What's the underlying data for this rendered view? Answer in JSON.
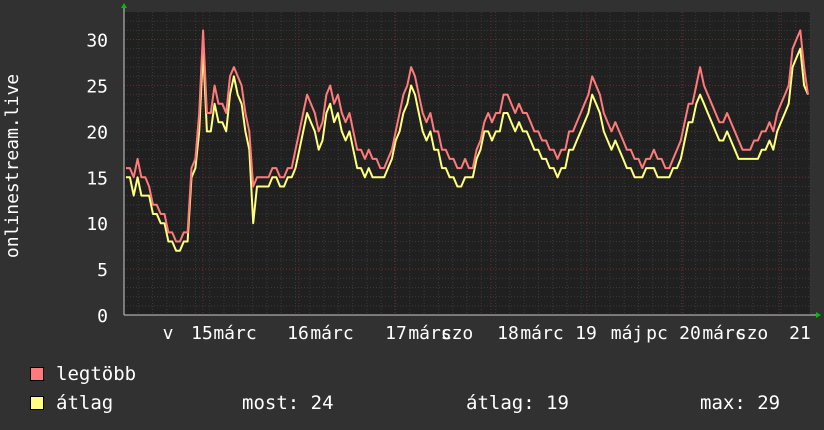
{
  "chart_data": {
    "type": "line",
    "ylabel": "onlinestream.live",
    "ylim": [
      0,
      33
    ],
    "yticks": [
      0,
      5,
      10,
      15,
      20,
      25,
      30
    ],
    "grid": true,
    "x_ticks": [
      "v",
      "15",
      "márc",
      "16",
      "márc",
      "17",
      "márc",
      "szo",
      "18",
      "márc",
      "19",
      "máj",
      "pc",
      "20",
      "márc",
      "szo",
      "21"
    ],
    "x_tick_labels_note_free": true,
    "series": [
      {
        "name": "legtöbb",
        "color": "#ff7b7b",
        "values": [
          16,
          16,
          15,
          17,
          15,
          15,
          14,
          12,
          12,
          11,
          11,
          9,
          9,
          8,
          8,
          9,
          9,
          16,
          17,
          22,
          31,
          22,
          22,
          25,
          23,
          23,
          22,
          26,
          27,
          26,
          25,
          22,
          20,
          14,
          15,
          15,
          15,
          15,
          16,
          16,
          15,
          15,
          16,
          16,
          18,
          20,
          22,
          24,
          23,
          22,
          20,
          21,
          24,
          25,
          23,
          24,
          22,
          21,
          22,
          20,
          18,
          18,
          17,
          18,
          17,
          17,
          16,
          16,
          17,
          18,
          20,
          22,
          24,
          25,
          27,
          26,
          24,
          22,
          21,
          22,
          20,
          20,
          18,
          18,
          17,
          17,
          16,
          16,
          17,
          16,
          16,
          18,
          19,
          21,
          22,
          21,
          22,
          22,
          24,
          24,
          23,
          22,
          23,
          22,
          22,
          21,
          20,
          20,
          19,
          19,
          18,
          18,
          17,
          18,
          18,
          20,
          20,
          21,
          22,
          23,
          24,
          26,
          25,
          24,
          22,
          21,
          20,
          21,
          20,
          19,
          18,
          18,
          17,
          17,
          16,
          17,
          17,
          18,
          17,
          17,
          16,
          16,
          17,
          18,
          19,
          21,
          23,
          23,
          25,
          27,
          25,
          24,
          23,
          22,
          21,
          21,
          22,
          21,
          20,
          19,
          18,
          18,
          18,
          19,
          19,
          20,
          20,
          21,
          20,
          22,
          23,
          24,
          25,
          29,
          30,
          31,
          27,
          24
        ],
        "_note": ""
      },
      {
        "name": "átlag",
        "color": "#ffff80",
        "values": [
          15,
          15,
          13,
          15,
          13,
          13,
          13,
          11,
          11,
          10,
          10,
          8,
          8,
          7,
          7,
          8,
          8,
          15,
          16,
          20,
          29,
          20,
          20,
          23,
          21,
          21,
          20,
          24,
          26,
          24,
          23,
          20,
          18,
          10,
          14,
          14,
          14,
          14,
          15,
          15,
          14,
          14,
          15,
          15,
          16,
          18,
          20,
          22,
          21,
          20,
          18,
          19,
          22,
          23,
          21,
          22,
          20,
          19,
          20,
          18,
          16,
          16,
          15,
          16,
          15,
          15,
          15,
          15,
          16,
          17,
          19,
          20,
          22,
          23,
          25,
          24,
          22,
          20,
          19,
          20,
          18,
          18,
          16,
          16,
          15,
          15,
          14,
          14,
          15,
          15,
          15,
          17,
          18,
          20,
          20,
          19,
          20,
          20,
          22,
          22,
          21,
          20,
          21,
          20,
          20,
          19,
          18,
          18,
          17,
          17,
          16,
          16,
          15,
          16,
          16,
          18,
          18,
          19,
          20,
          21,
          22,
          24,
          23,
          22,
          20,
          19,
          18,
          19,
          18,
          17,
          16,
          16,
          15,
          15,
          15,
          16,
          16,
          16,
          15,
          15,
          15,
          15,
          16,
          16,
          17,
          19,
          21,
          21,
          23,
          24,
          23,
          22,
          21,
          20,
          19,
          19,
          20,
          19,
          18,
          17,
          17,
          17,
          17,
          17,
          17,
          18,
          18,
          19,
          18,
          20,
          21,
          22,
          23,
          27,
          28,
          29,
          25,
          24
        ]
      }
    ]
  },
  "legend": {
    "items": [
      {
        "label": "legtöbb",
        "color": "#ff7b7b"
      },
      {
        "label": "átlag",
        "color": "#ffff80"
      }
    ]
  },
  "stats": {
    "most": "most: 24",
    "atlag": "átlag: 19",
    "max": "max: 29"
  }
}
